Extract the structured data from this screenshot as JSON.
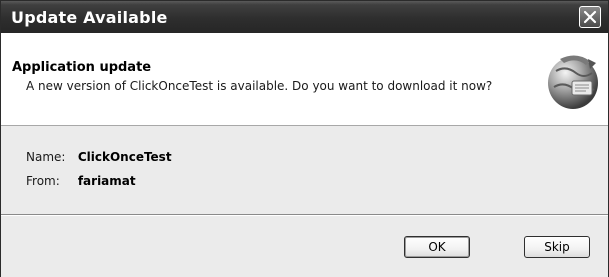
{
  "window": {
    "title": "Update Available"
  },
  "header": {
    "title": "Application update",
    "description": "A new version of ClickOnceTest is available. Do you want to download it now?"
  },
  "info": {
    "name_label": "Name:",
    "name_value": "ClickOnceTest",
    "from_label": "From:",
    "from_value": "fariamat"
  },
  "buttons": {
    "ok_label": "OK",
    "skip_label": "Skip"
  },
  "icons": {
    "close": "close-icon",
    "globe": "globe-update-icon"
  }
}
